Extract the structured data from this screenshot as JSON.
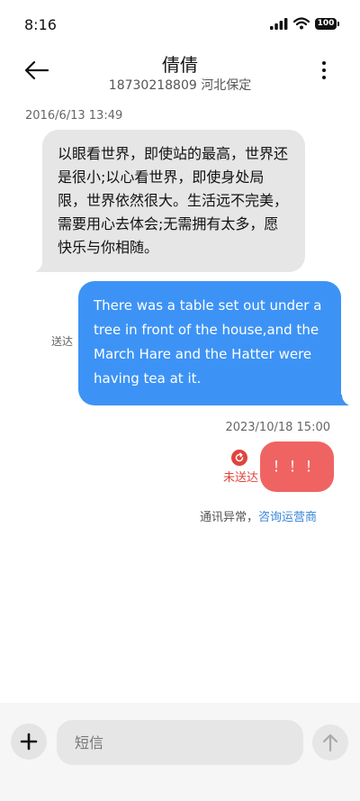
{
  "status_bar": {
    "time": "8:16",
    "battery": "100",
    "icons": [
      "signal-icon",
      "wifi-icon",
      "battery-icon"
    ]
  },
  "header": {
    "contact_name": "倩倩",
    "contact_subtitle": "18730218809 河北保定",
    "icons": [
      "back-arrow-icon",
      "more-vertical-icon"
    ]
  },
  "messages": {
    "received": {
      "timestamp": "2016/6/13 13:49",
      "text": "以眼看世界，即使站的最高，世界还是很小;以心看世界，即使身处局限，世界依然很大。生活远不完美，需要用心去体会;无需拥有太多，愿快乐与你相随。"
    },
    "sent": {
      "text": "There was a table set out under a tree in front of the house,and the March Hare and the Hatter were having tea at it.",
      "status_label": "送达"
    },
    "failed": {
      "timestamp": "2023/10/18 15:00",
      "text": "！！！",
      "status_label": "未送达",
      "error_text": "通讯异常，",
      "error_link": "咨询运营商"
    }
  },
  "input_bar": {
    "placeholder": "短信",
    "icons": [
      "plus-icon",
      "send-arrow-up-icon"
    ]
  },
  "colors": {
    "sent_bubble": "#3d93f5",
    "received_bubble": "#e6e6e6",
    "failed_bubble": "#ef6462",
    "failed_label": "#e0443e",
    "link": "#3a86d9"
  }
}
